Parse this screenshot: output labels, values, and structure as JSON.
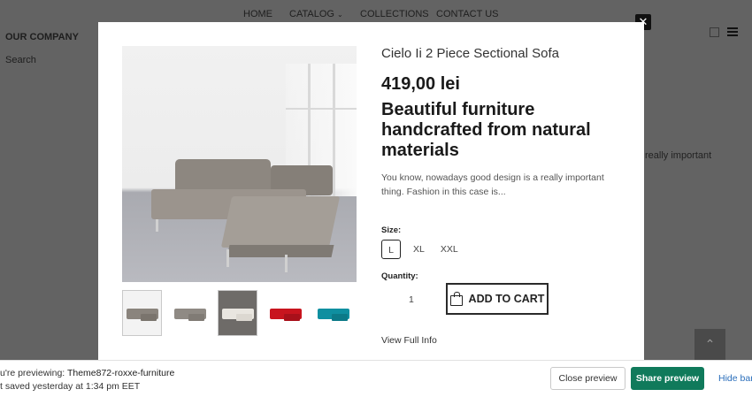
{
  "nav": {
    "home": "HOME",
    "catalog": "CATALOG",
    "collections": "COLLECTIONS",
    "contact": "CONTACT US"
  },
  "sidebar": {
    "company": "OUR COMPANY",
    "search": "Search"
  },
  "background": {
    "right_text": "really important"
  },
  "product": {
    "title": "Cielo Ii 2 Piece Sectional Sofa",
    "price": "419,00 lei",
    "headline": "Beautiful furniture handcrafted from natural materials",
    "description": "You know, nowadays good design is a really important thing. Fashion in this case is...",
    "size_label": "Size:",
    "sizes": [
      "L",
      "XL",
      "XXL"
    ],
    "selected_size": "L",
    "quantity_label": "Quantity:",
    "quantity": "1",
    "add_to_cart": "ADD TO CART",
    "full_info": "View Full Info",
    "thumbnail_colors": [
      "#8a847d",
      "#8f8a84",
      "#e9e6e0",
      "#c8141e",
      "#0f8fa0"
    ]
  },
  "preview_bar": {
    "line1_prefix": "u're previewing: ",
    "theme_name": "Theme872-roxxe-furniture",
    "line2": "t saved yesterday at 1:34 pm EET",
    "close_label": "Close preview",
    "share_label": "Share preview",
    "hide_label": "Hide bar"
  },
  "icons": {
    "close": "close-icon",
    "grid": "grid-view-icon",
    "list": "list-view-icon",
    "bag": "bag-icon",
    "scroll_top": "chevron-up-icon",
    "catalog_dropdown": "chevron-down-icon"
  }
}
